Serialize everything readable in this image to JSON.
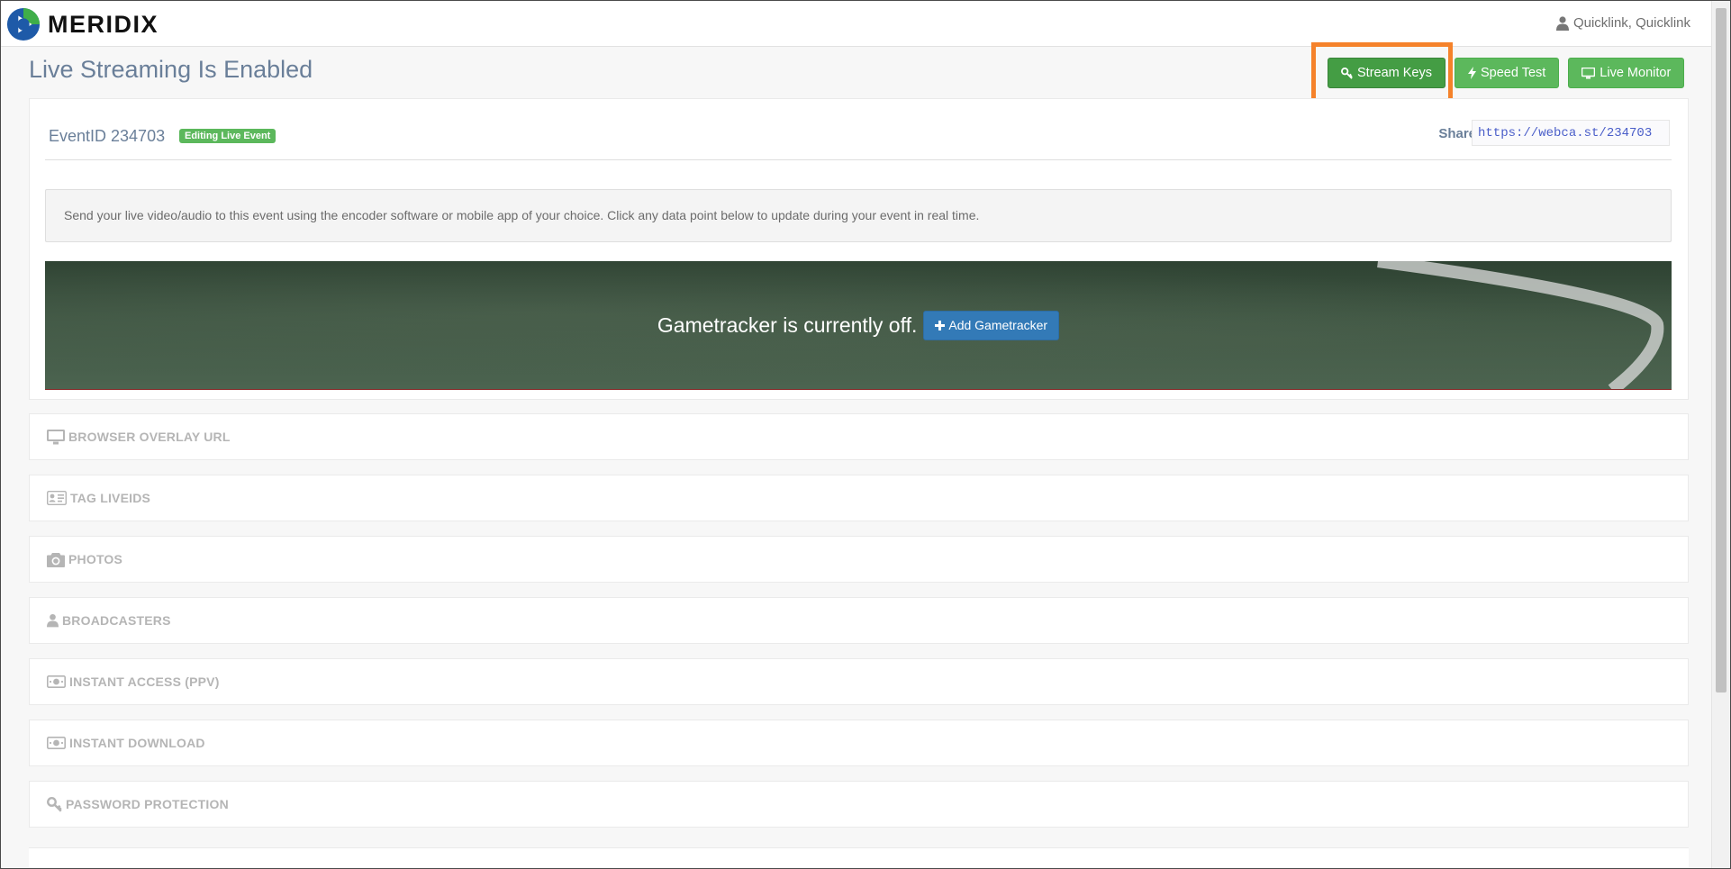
{
  "brand": {
    "name": "MERIDIX"
  },
  "user": {
    "name": "Quicklink, Quicklink"
  },
  "page": {
    "title": "Live Streaming Is Enabled"
  },
  "actions": {
    "stream_keys": "Stream Keys",
    "speed_test": "Speed Test",
    "live_monitor": "Live Monitor"
  },
  "event": {
    "id_label": "EventID 234703",
    "badge": "Editing Live Event",
    "share_label": "Share:",
    "share_url": "https://webca.st/234703"
  },
  "info": {
    "text": "Send your live video/audio to this event using the encoder software or mobile app of your choice. Click any data point below to update during your event in real time."
  },
  "gametracker": {
    "status": "Gametracker is currently off.",
    "add_label": "Add Gametracker"
  },
  "sections": [
    {
      "label": "BROWSER OVERLAY URL",
      "icon": "monitor-icon"
    },
    {
      "label": "TAG LIVEIDS",
      "icon": "id-card-icon"
    },
    {
      "label": "PHOTOS",
      "icon": "camera-icon"
    },
    {
      "label": "BROADCASTERS",
      "icon": "user-icon"
    },
    {
      "label": "INSTANT ACCESS (PPV)",
      "icon": "money-icon"
    },
    {
      "label": "INSTANT DOWNLOAD",
      "icon": "money-icon"
    },
    {
      "label": "PASSWORD PROTECTION",
      "icon": "key-icon"
    }
  ],
  "colors": {
    "accent_green": "#5cb85c",
    "primary_blue": "#337ab7",
    "highlight_orange": "#f5822a",
    "title_slate": "#6a7f99"
  }
}
